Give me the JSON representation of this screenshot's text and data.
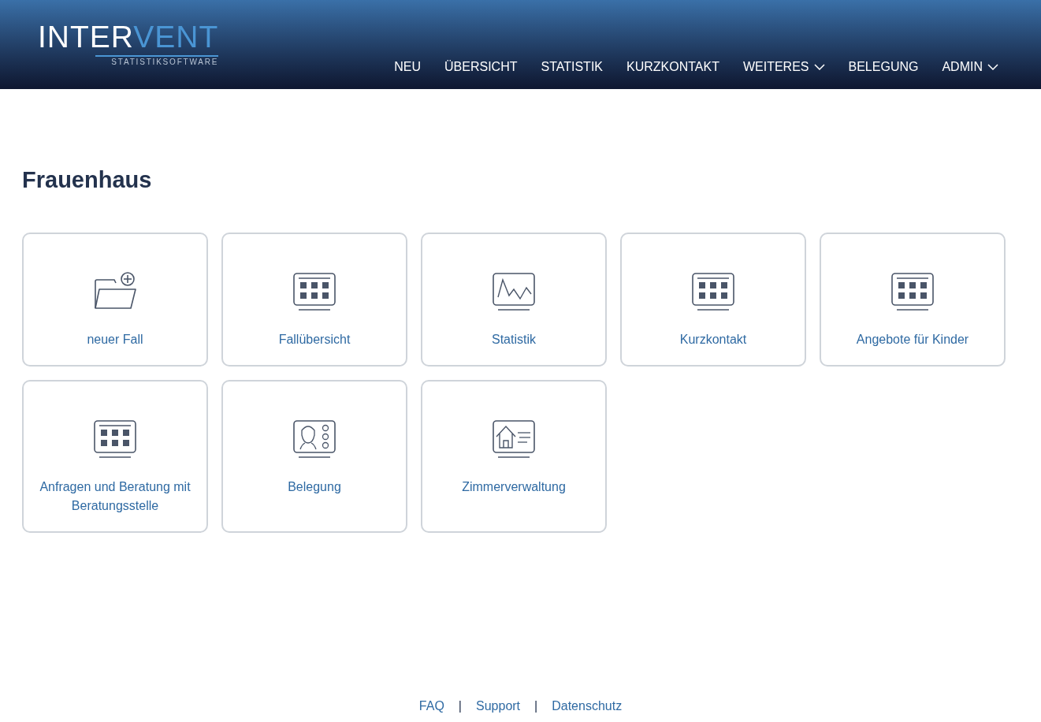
{
  "logo": {
    "wordmark_primary": "INTER",
    "wordmark_accent": "VENT",
    "tagline": "STATISTIKSOFTWARE"
  },
  "nav": [
    {
      "label": "NEU",
      "dropdown": false
    },
    {
      "label": "ÜBERSICHT",
      "dropdown": false
    },
    {
      "label": "STATISTIK",
      "dropdown": false
    },
    {
      "label": "KURZKONTAKT",
      "dropdown": false
    },
    {
      "label": "WEITERES",
      "dropdown": true
    },
    {
      "label": "BELEGUNG",
      "dropdown": false
    },
    {
      "label": "ADMIN",
      "dropdown": true
    }
  ],
  "page_title": "Frauenhaus",
  "tiles": [
    {
      "label": "neuer Fall",
      "kind": "folder"
    },
    {
      "label": "Fallübersicht",
      "kind": "grid"
    },
    {
      "label": "Statistik",
      "kind": "chart"
    },
    {
      "label": "Kurzkontakt",
      "kind": "grid"
    },
    {
      "label": "Angebote für Kinder",
      "kind": "grid"
    },
    {
      "label": "Anfragen und Beratung mit Beratungsstelle",
      "kind": "grid"
    },
    {
      "label": "Belegung",
      "kind": "person"
    },
    {
      "label": "Zimmerverwaltung",
      "kind": "house"
    }
  ],
  "footer": [
    {
      "label": "FAQ"
    },
    {
      "label": "Support"
    },
    {
      "label": "Datenschutz"
    }
  ],
  "footer_separator": "|"
}
